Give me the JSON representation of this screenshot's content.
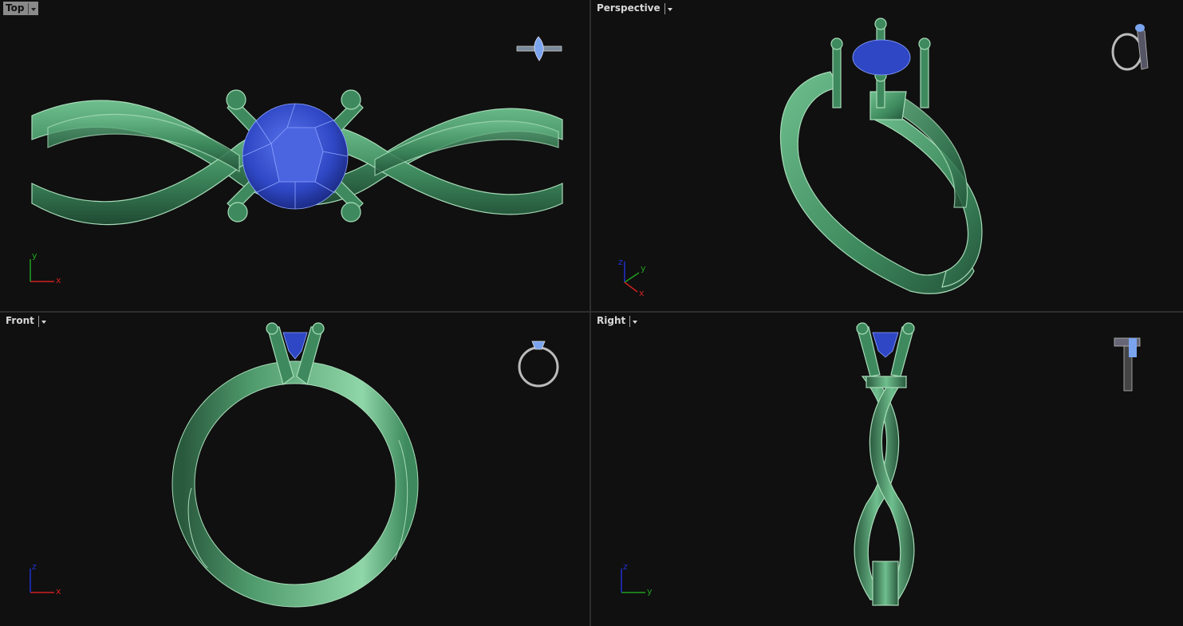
{
  "viewports": {
    "top": {
      "label": "Top",
      "active": true,
      "axes": [
        "y",
        "x"
      ]
    },
    "perspective": {
      "label": "Perspective",
      "active": false,
      "axes": [
        "z",
        "y",
        "x"
      ]
    },
    "front": {
      "label": "Front",
      "active": false,
      "axes": [
        "z",
        "x"
      ]
    },
    "right": {
      "label": "Right",
      "active": false,
      "axes": [
        "z",
        "y"
      ]
    }
  },
  "icons": {
    "dropdown": "chevron-down-icon",
    "axis_widget": "axis-triad-icon",
    "thumbnail": "ring-thumbnail-icon"
  },
  "colors": {
    "viewport_bg": "#101010",
    "ring_metal": "#3e8a5e",
    "gem": "#2f47c4",
    "x_axis": "#d02020",
    "y_axis": "#20a020",
    "z_axis": "#2030d0"
  }
}
